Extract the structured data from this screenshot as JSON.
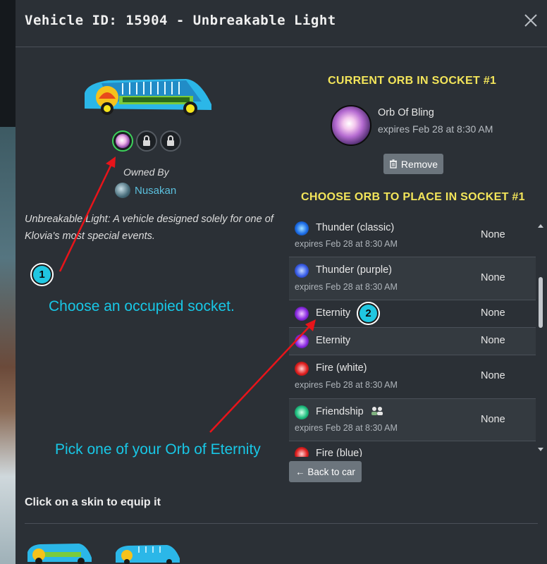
{
  "modal": {
    "title": "Vehicle ID: 15904 - Unbreakable Light"
  },
  "vehicle": {
    "owned_by_label": "Owned By",
    "owner_name": "Nusakan",
    "description": "Unbreakable Light: A vehicle designed solely for one of Klovia's most special events."
  },
  "current_orb": {
    "heading": "CURRENT ORB IN SOCKET #1",
    "name": "Orb Of Bling",
    "expires": "expires Feb 28 at 8:30 AM",
    "remove_label": "Remove"
  },
  "choose": {
    "heading": "CHOOSE ORB TO PLACE IN SOCKET #1",
    "rows": [
      {
        "name": "Thunder (classic)",
        "expires": "expires Feb 28 at 8:30 AM",
        "value": "None"
      },
      {
        "name": "Thunder (purple)",
        "expires": "expires Feb 28 at 8:30 AM",
        "value": "None"
      },
      {
        "name": "Eternity",
        "expires": "",
        "value": "None"
      },
      {
        "name": "Eternity",
        "expires": "",
        "value": "None"
      },
      {
        "name": "Fire (white)",
        "expires": "expires Feb 28 at 8:30 AM",
        "value": "None"
      },
      {
        "name": "Friendship",
        "expires": "expires Feb 28 at 8:30 AM",
        "value": "None"
      },
      {
        "name": "Fire (blue)",
        "expires": "",
        "value": ""
      }
    ]
  },
  "back_label": "← Back to car",
  "skins_heading": "Click on a skin to equip it",
  "annotations": {
    "step1_number": "1",
    "step1_text": "Choose an occupied socket.",
    "step2_number": "2",
    "step2_text": "Pick one of your Orb of Eternity"
  },
  "colors": {
    "accent_yellow": "#f3e55a",
    "link_blue": "#5bc0de",
    "annotation_cyan": "#18c7e6",
    "arrow_red": "#e8141a",
    "socket_active": "#3dd35a"
  }
}
